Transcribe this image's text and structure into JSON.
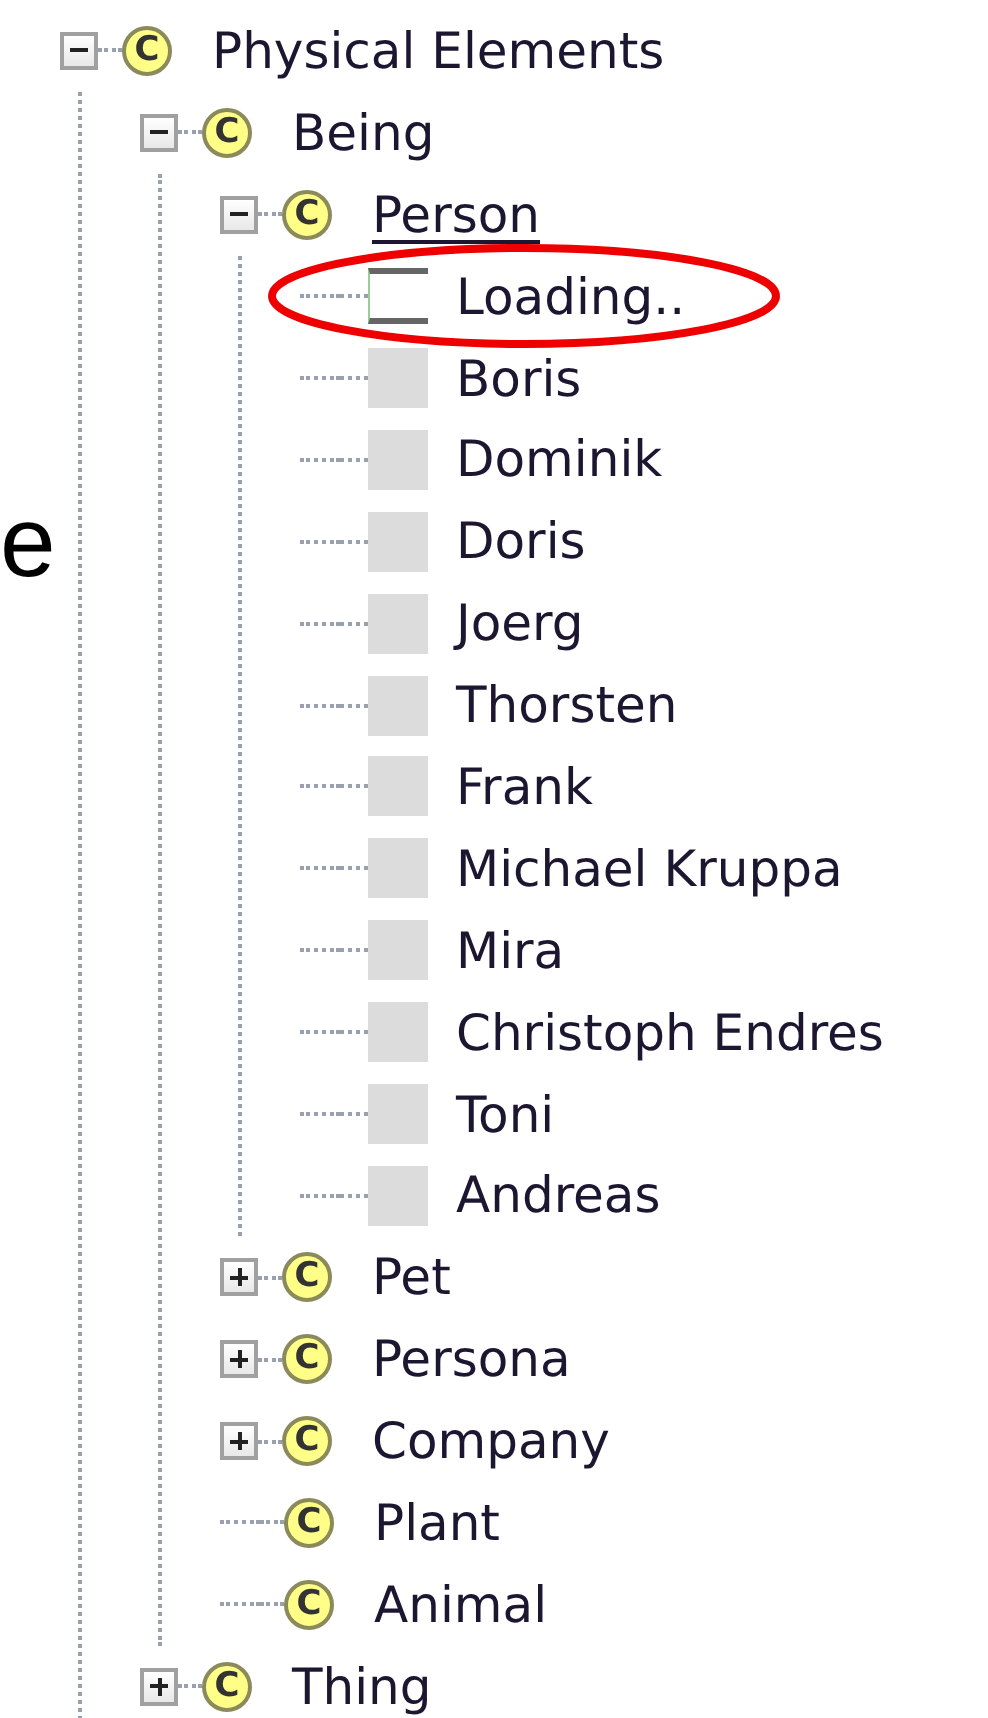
{
  "cut_text": "e",
  "tree": [
    {
      "kind": "class",
      "badge": "C",
      "label": "Physical Elements",
      "expanded": true,
      "children": [
        {
          "kind": "class",
          "badge": "C",
          "label": "Being",
          "expanded": true,
          "children": [
            {
              "kind": "class",
              "badge": "C",
              "label": "Person",
              "expanded": true,
              "underlined": true,
              "children": [
                {
                  "kind": "loading",
                  "label": "Loading..",
                  "highlighted": true
                },
                {
                  "kind": "item",
                  "label": "Boris"
                },
                {
                  "kind": "item",
                  "label": "Dominik"
                },
                {
                  "kind": "item",
                  "label": "Doris"
                },
                {
                  "kind": "item",
                  "label": "Joerg"
                },
                {
                  "kind": "item",
                  "label": "Thorsten"
                },
                {
                  "kind": "item",
                  "label": "Frank"
                },
                {
                  "kind": "item",
                  "label": "Michael Kruppa"
                },
                {
                  "kind": "item",
                  "label": "Mira"
                },
                {
                  "kind": "item",
                  "label": "Christoph Endres"
                },
                {
                  "kind": "item",
                  "label": "Toni"
                },
                {
                  "kind": "item",
                  "label": "Andreas"
                }
              ]
            },
            {
              "kind": "class",
              "badge": "C",
              "label": "Pet",
              "expanded": false
            },
            {
              "kind": "class",
              "badge": "C",
              "label": "Persona",
              "expanded": false
            },
            {
              "kind": "class",
              "badge": "C",
              "label": "Company",
              "expanded": false
            },
            {
              "kind": "class",
              "badge": "C",
              "label": "Plant"
            },
            {
              "kind": "class",
              "badge": "C",
              "label": "Animal"
            }
          ]
        },
        {
          "kind": "class",
          "badge": "C",
          "label": "Thing",
          "expanded": false
        }
      ]
    }
  ]
}
